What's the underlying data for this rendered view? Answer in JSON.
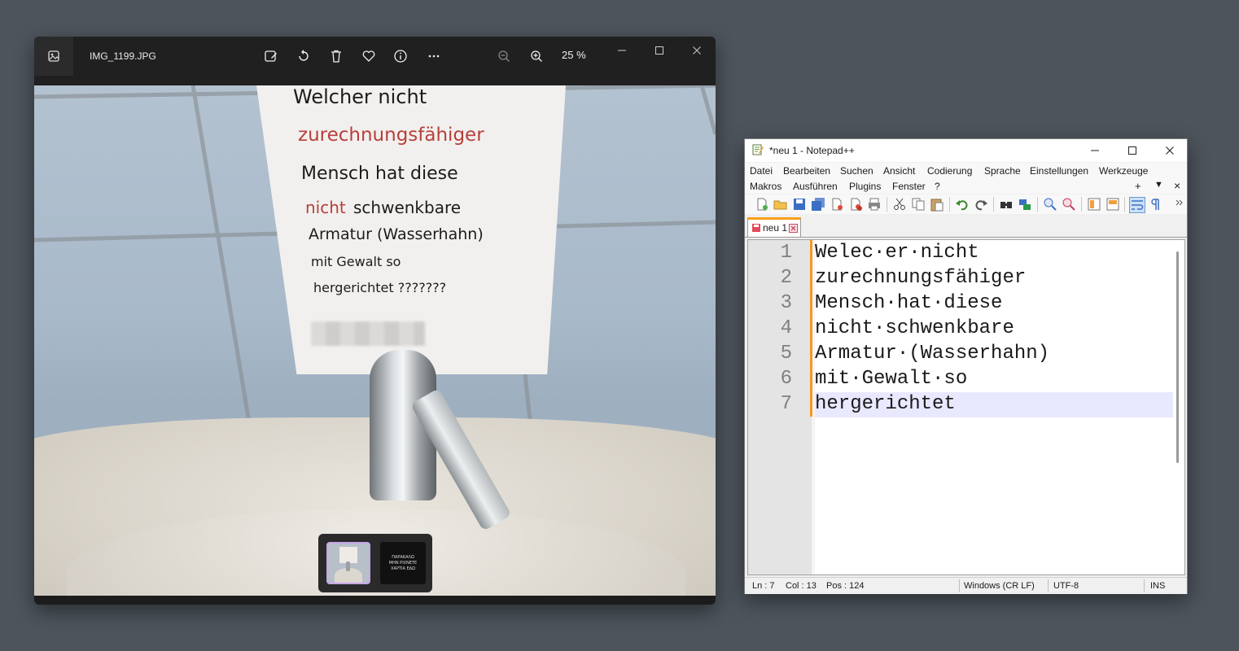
{
  "photos": {
    "filename": "IMG_1199.JPG",
    "zoom": "25 %",
    "toolbar_icons": [
      "edit-image-icon",
      "rotate-icon",
      "delete-icon",
      "favorite-icon",
      "info-icon",
      "more-icon"
    ],
    "zoom_icons": [
      "zoom-out-icon",
      "zoom-in-icon"
    ],
    "sign_lines": [
      "Welcher nicht",
      "zurechnungsfähiger",
      "Mensch hat diese",
      "nicht",
      "schwenkbare",
      "Armatur (Wasserhahn)",
      "mit Gewalt so",
      "hergerichtet ???????"
    ],
    "sign_red_color": "#b5403b",
    "thumb2_text": [
      "ΠΑΡΑΚΑΛΩ",
      "ΜΗΝ ΡΙΧΝΕΤΕ",
      "ΧΑΡΤΙΑ ΕΔΩ"
    ]
  },
  "notepad": {
    "title": "*neu 1 - Notepad++",
    "menu_row1": [
      "Datei",
      "Bearbeiten",
      "Suchen",
      "Ansicht",
      "Codierung",
      "Sprache",
      "Einstellungen",
      "Werkzeuge"
    ],
    "menu_row2": [
      "Makros",
      "Ausführen",
      "Plugins",
      "Fenster",
      "?"
    ],
    "menu_extra": [
      "+",
      "▼",
      "×"
    ],
    "tab_label": "neu 1",
    "lines": [
      {
        "num": "1",
        "text": "Welec·er·nicht"
      },
      {
        "num": "2",
        "text": "zurechnungsfähiger"
      },
      {
        "num": "3",
        "text": "Mensch·hat·diese"
      },
      {
        "num": "4",
        "text": "nicht·schwenkbare"
      },
      {
        "num": "5",
        "text": "Armatur·(Wasserhahn)"
      },
      {
        "num": "6",
        "text": "mit·Gewalt·so"
      },
      {
        "num": "7",
        "text": "hergerichtet"
      }
    ],
    "status": {
      "ln": "Ln : 7",
      "col": "Col : 13",
      "pos": "Pos : 124",
      "eol": "Windows (CR LF)",
      "encoding": "UTF-8",
      "mode": "INS"
    },
    "accent_color": "#fa9e1b"
  }
}
